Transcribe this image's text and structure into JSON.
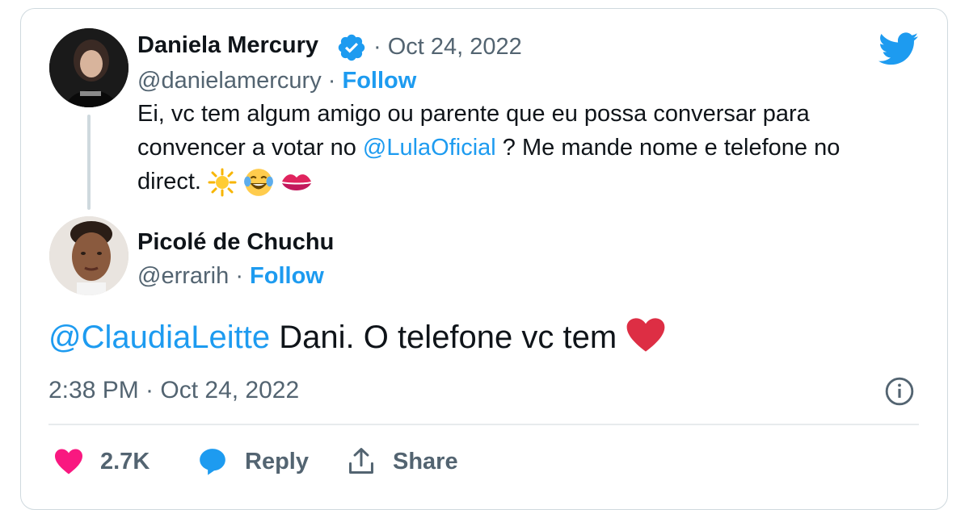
{
  "quoted_tweet": {
    "author_name": "Daniela Mercury",
    "separator_date": "· Oct 24, 2022",
    "handle": "@danielamercury",
    "dot": "·",
    "follow_label": "Follow",
    "text_line1": "Ei, vc tem algum amigo ou parente que eu possa conversar para",
    "text_line2_pre": "convencer a votar no ",
    "mention": "@LulaOficial",
    "text_line2_post": " ? Me mande nome e telefone no",
    "text_line3": "direct."
  },
  "reply_tweet": {
    "author_name": "Picolé de Chuchu",
    "handle": "@errarih",
    "dot": "·",
    "follow_label": "Follow",
    "mention": "@ClaudiaLeitte",
    "text": " Dani. O telefone vc tem",
    "timestamp": "2:38 PM · Oct 24, 2022"
  },
  "actions": {
    "like_count": "2.7K",
    "reply_label": "Reply",
    "share_label": "Share"
  },
  "colors": {
    "accent": "#1d9bf0",
    "muted": "#536471",
    "like": "#f91880"
  },
  "icons": [
    "twitter-bird-icon",
    "verified-badge-icon",
    "sun-emoji",
    "laughing-tears-emoji",
    "kiss-lips-emoji",
    "red-heart-emoji",
    "info-icon",
    "heart-icon",
    "reply-bubble-icon",
    "share-icon"
  ]
}
